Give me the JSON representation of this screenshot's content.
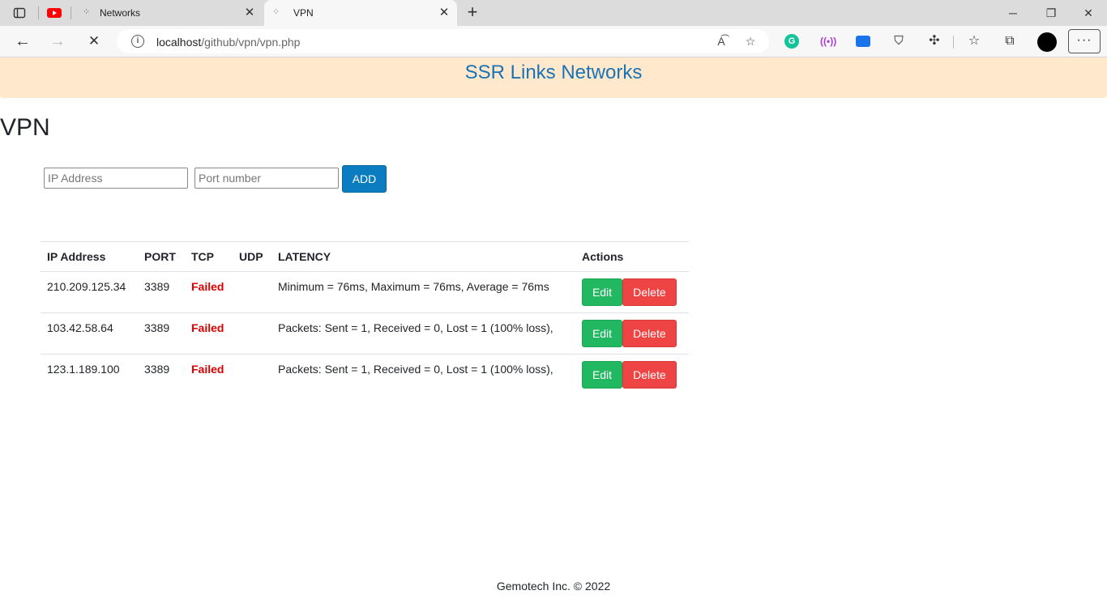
{
  "browser": {
    "tabs": [
      {
        "title": "Networks"
      },
      {
        "title": "VPN"
      }
    ],
    "url_host": "localhost",
    "url_path": "/github/vpn/vpn.php",
    "close_glyph": "✕",
    "new_tab_glyph": "+"
  },
  "page": {
    "site_title": "SSR Links Networks",
    "heading": "VPN",
    "form": {
      "ip_placeholder": "IP Address",
      "port_placeholder": "Port number",
      "add_label": "ADD"
    },
    "table": {
      "columns": [
        "IP Address",
        "PORT",
        "TCP",
        "UDP",
        "LATENCY",
        "Actions"
      ],
      "rows": [
        {
          "ip": "210.209.125.34",
          "port": "3389",
          "tcp": "Failed",
          "udp": "",
          "latency": "Minimum = 76ms, Maximum = 76ms, Average = 76ms"
        },
        {
          "ip": "103.42.58.64",
          "port": "3389",
          "tcp": "Failed",
          "udp": "",
          "latency": "Packets: Sent = 1, Received = 0, Lost = 1 (100% loss),"
        },
        {
          "ip": "123.1.189.100",
          "port": "3389",
          "tcp": "Failed",
          "udp": "",
          "latency": "Packets: Sent = 1, Received = 0, Lost = 1 (100% loss),"
        }
      ],
      "edit_label": "Edit",
      "delete_label": "Delete"
    },
    "footer": "Gemotech Inc. © 2022"
  },
  "colors": {
    "header_bg": "#ffe8cb",
    "title_blue": "#1a73b5",
    "add_button": "#0b7cbf",
    "edit_button": "#22b862",
    "delete_button": "#ef4444",
    "failed_text": "#e00000"
  }
}
